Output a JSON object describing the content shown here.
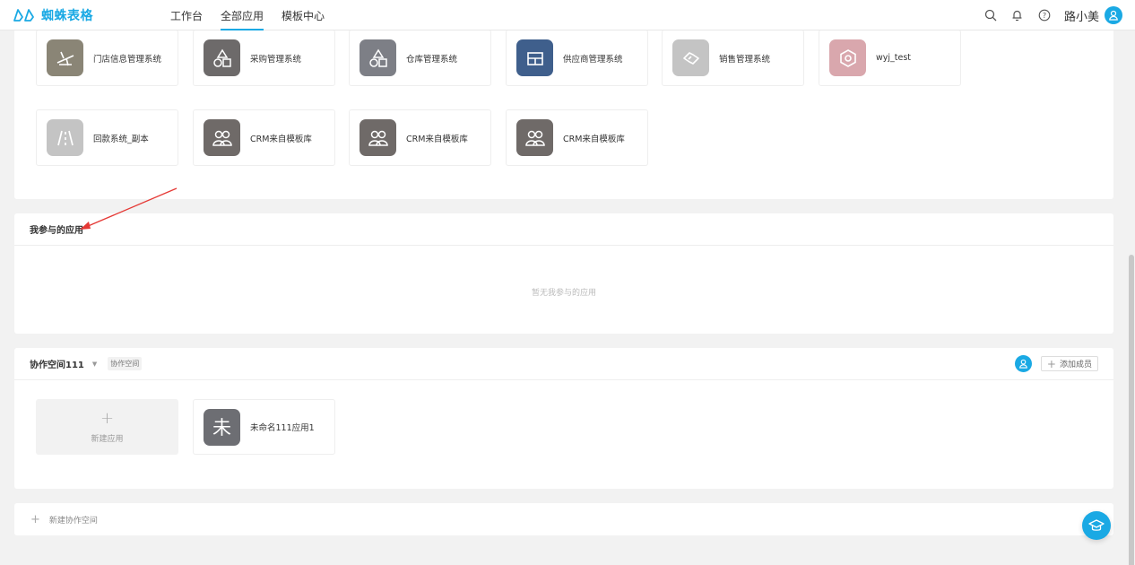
{
  "header": {
    "brand": "蜘蛛表格",
    "nav": [
      {
        "label": "工作台",
        "active": false
      },
      {
        "label": "全部应用",
        "active": true
      },
      {
        "label": "模板中心",
        "active": false
      }
    ],
    "username": "路小美",
    "icons": [
      "search-icon",
      "bell-icon",
      "help-icon",
      "user-icon"
    ]
  },
  "apps_row1": [
    {
      "name": "门店信息管理系统",
      "icon": "plane-icon"
    },
    {
      "name": "采购管理系统",
      "icon": "shapes-icon"
    },
    {
      "name": "仓库管理系统",
      "icon": "shapes-icon"
    },
    {
      "name": "供应商管理系统",
      "icon": "grid-icon"
    },
    {
      "name": "销售管理系统",
      "icon": "handshake-icon"
    },
    {
      "name": "wyj_test",
      "icon": "hexagon-icon"
    }
  ],
  "apps_row2": [
    {
      "name": "回款系统_副本",
      "icon": "road-icon"
    },
    {
      "name": "CRM来自模板库",
      "icon": "people-icon"
    },
    {
      "name": "CRM来自模板库",
      "icon": "people-icon"
    },
    {
      "name": "CRM来自模板库",
      "icon": "people-icon"
    }
  ],
  "participate": {
    "title": "我参与的应用",
    "empty": "暂无我参与的应用"
  },
  "space": {
    "name": "协作空间111",
    "tag": "协作空间",
    "add_member": "添加成员",
    "new_app": "新建应用",
    "apps": [
      {
        "name": "未命名111应用1",
        "icon_char": "未"
      }
    ]
  },
  "new_space": "新建协作空间",
  "colors": {
    "accent": "#1aa9e4",
    "annotation": "#e53935"
  }
}
